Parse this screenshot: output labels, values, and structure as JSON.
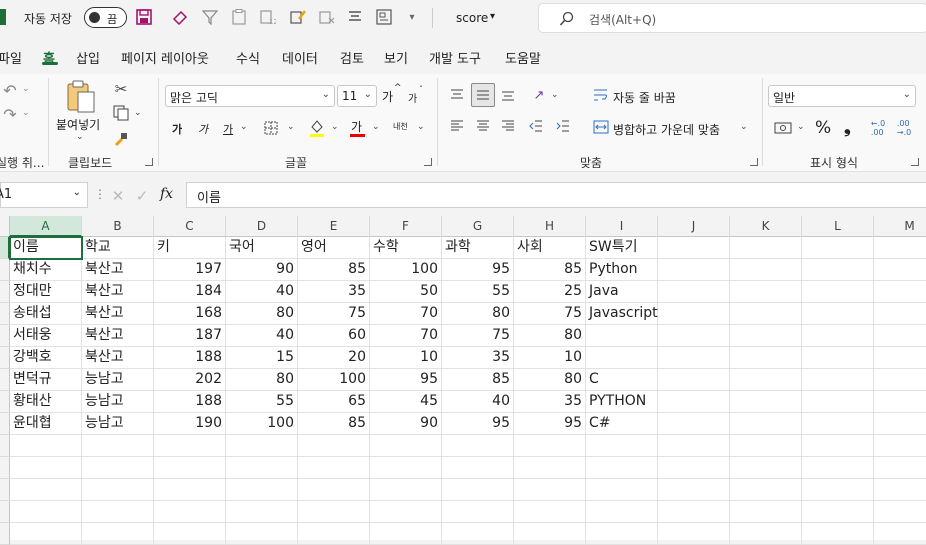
{
  "titlebar": {
    "autosave_label": "자동 저장",
    "autosave_state": "끔",
    "filename": "score",
    "filename_caret": "▾",
    "search_placeholder": "검색(Alt+Q)"
  },
  "menu": [
    "파일",
    "홈",
    "삽입",
    "페이지 레이아웃",
    "수식",
    "데이터",
    "검토",
    "보기",
    "개발 도구",
    "도움말"
  ],
  "ribbon": {
    "undo_group_label": "실행 취...",
    "paste_label": "붙여넣기",
    "clipboard_label": "클립보드",
    "font_name": "맑은 고딕",
    "font_size": "11",
    "grow_font": "가",
    "shrink_font": "가",
    "bold": "가",
    "italic": "가",
    "underline": "가",
    "font_color_glyph": "가",
    "phonetic": "내천",
    "font_group_label": "글꼴",
    "wrap_text": "자동 줄 바꿈",
    "merge_center": "병합하고 가운데 맞춤",
    "align_group_label": "맞춤",
    "number_format": "일반",
    "percent": "%",
    "comma": "❟",
    "number_group_label": "표시 형식",
    "accent_color": "#1e6e3c"
  },
  "formula_bar": {
    "name_box": "A1",
    "fx_label": "fx",
    "formula": "이름"
  },
  "sheet": {
    "columns": [
      "A",
      "B",
      "C",
      "D",
      "E",
      "F",
      "G",
      "H",
      "I",
      "J",
      "K",
      "L",
      "M"
    ],
    "header": [
      "이름",
      "학교",
      "키",
      "국어",
      "영어",
      "수학",
      "과학",
      "사회",
      "SW특기"
    ],
    "rows": [
      [
        "채치수",
        "북산고",
        "197",
        "90",
        "85",
        "100",
        "95",
        "85",
        "Python"
      ],
      [
        "정대만",
        "북산고",
        "184",
        "40",
        "35",
        "50",
        "55",
        "25",
        "Java"
      ],
      [
        "송태섭",
        "북산고",
        "168",
        "80",
        "75",
        "70",
        "80",
        "75",
        "Javascript"
      ],
      [
        "서태웅",
        "북산고",
        "187",
        "40",
        "60",
        "70",
        "75",
        "80",
        ""
      ],
      [
        "강백호",
        "북산고",
        "188",
        "15",
        "20",
        "10",
        "35",
        "10",
        ""
      ],
      [
        "변덕규",
        "능남고",
        "202",
        "80",
        "100",
        "95",
        "85",
        "80",
        "C"
      ],
      [
        "황태산",
        "능남고",
        "188",
        "55",
        "65",
        "45",
        "40",
        "35",
        "PYTHON"
      ],
      [
        "윤대협",
        "능남고",
        "190",
        "100",
        "85",
        "90",
        "95",
        "95",
        "C#"
      ]
    ]
  }
}
